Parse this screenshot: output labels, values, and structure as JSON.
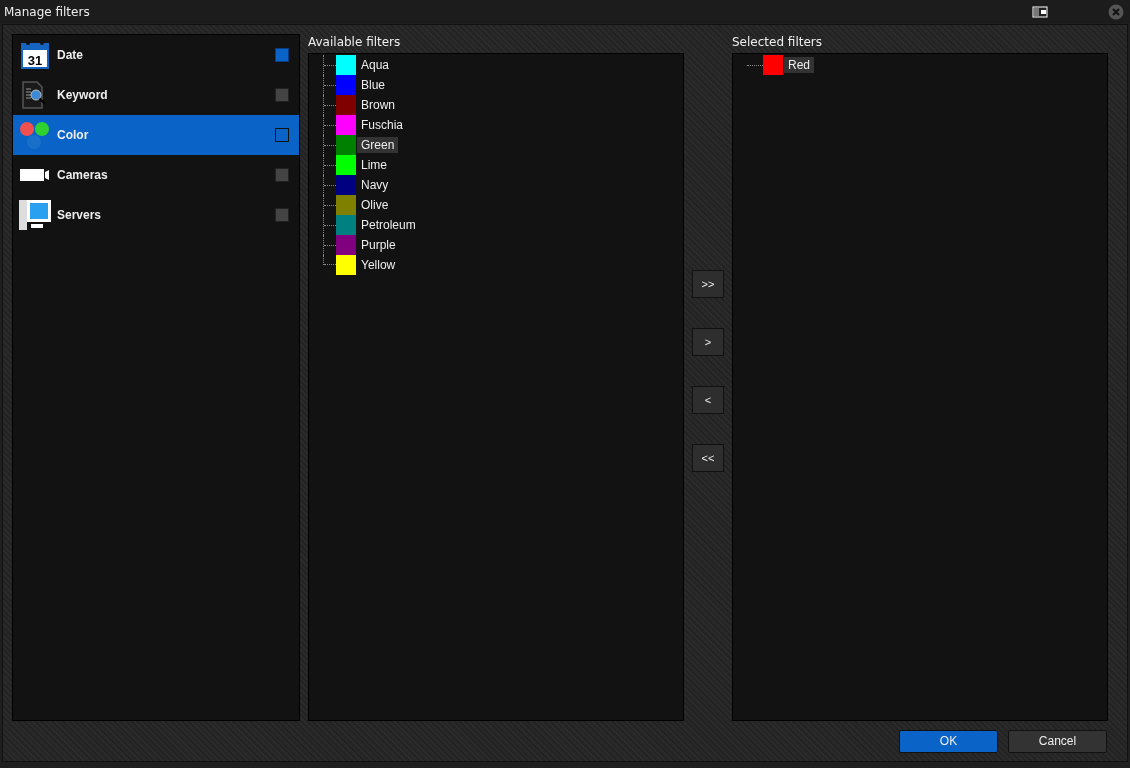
{
  "window": {
    "title": "Manage filters"
  },
  "categories": [
    {
      "label": "Date",
      "selected": false,
      "checked": true,
      "icon_text": "31"
    },
    {
      "label": "Keyword",
      "selected": false,
      "checked": false
    },
    {
      "label": "Color",
      "selected": true,
      "checked": false
    },
    {
      "label": "Cameras",
      "selected": false,
      "checked": false
    },
    {
      "label": "Servers",
      "selected": false,
      "checked": false
    }
  ],
  "available": {
    "title": "Available filters",
    "items": [
      {
        "label": "Aqua",
        "color": "#00ffff",
        "selected": false
      },
      {
        "label": "Blue",
        "color": "#0000ff",
        "selected": false
      },
      {
        "label": "Brown",
        "color": "#800000",
        "selected": false
      },
      {
        "label": "Fuschia",
        "color": "#ff00ff",
        "selected": false
      },
      {
        "label": "Green",
        "color": "#008000",
        "selected": true
      },
      {
        "label": "Lime",
        "color": "#00ff00",
        "selected": false
      },
      {
        "label": "Navy",
        "color": "#000080",
        "selected": false
      },
      {
        "label": "Olive",
        "color": "#808000",
        "selected": false
      },
      {
        "label": "Petroleum",
        "color": "#008080",
        "selected": false
      },
      {
        "label": "Purple",
        "color": "#800080",
        "selected": false
      },
      {
        "label": "Yellow",
        "color": "#ffff00",
        "selected": false
      }
    ]
  },
  "transfer_buttons": [
    ">>",
    ">",
    "<",
    "<<"
  ],
  "selected_filters": {
    "title": "Selected filters",
    "items": [
      {
        "label": "Red",
        "color": "#ff0000",
        "selected": true
      }
    ]
  },
  "buttons": [
    {
      "label": "OK",
      "kind": "primary"
    },
    {
      "label": "Cancel",
      "kind": "secondary"
    }
  ]
}
